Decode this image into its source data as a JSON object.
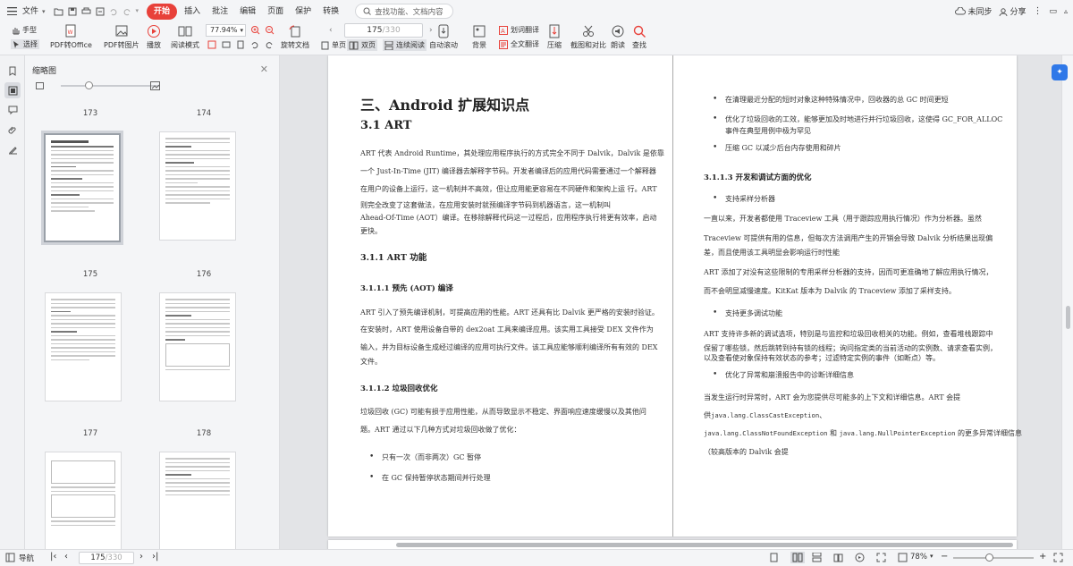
{
  "menubar": {
    "file_label": "文件",
    "menus": [
      "开始",
      "插入",
      "批注",
      "编辑",
      "页面",
      "保护",
      "转换"
    ],
    "search_placeholder": "查找功能、文档内容",
    "sync_label": "未同步",
    "share_label": "分享"
  },
  "toolbar": {
    "hand_label": "手型",
    "select_label": "选择",
    "pdf_to_office": "PDF转Office",
    "pdf_to_image": "PDF转图片",
    "play": "播放",
    "read_mode": "阅读模式",
    "zoom_value": "77.94%",
    "rotate": "旋转文档",
    "single_page": "单页",
    "double_page": "双页",
    "continuous": "连续阅读",
    "auto_scroll": "自动滚动",
    "background": "背景",
    "translate_word": "划词翻译",
    "translate_full": "全文翻译",
    "compress": "压缩",
    "screenshot_compare": "截图和对比",
    "read_aloud": "朗读",
    "find": "查找",
    "page_current": "175",
    "page_total": "/330"
  },
  "thumbpanel": {
    "title": "缩略图",
    "page_labels": [
      "173",
      "174",
      "175",
      "176",
      "177",
      "178"
    ]
  },
  "document": {
    "left": {
      "chapter": "三、Android 扩展知识点",
      "section": "3.1 ART",
      "intro_lines": [
        "ART 代表 Android Runtime，其处理应用程序执行的方式完全不同于 Dalvik，Dalvik 是依靠",
        "一个 Just-In-Time (JIT) 编译器去解释字节码。开发者编译后的应用代码需要通过一个解释器",
        "在用户的设备上运行，这一机制并不高效，但让应用能更容易在不同硬件和架构上运 行。ART",
        "则完全改变了这套做法，在应用安装时就预编译字节码到机器语言，这一机制叫",
        "Ahead-Of-Time (AOT）编译。在移除解释代码这一过程后，应用程序执行将更有效率，启动",
        "更快。"
      ],
      "h_311": "3.1.1 ART 功能",
      "h_3111": "3.1.1.1 预先 (AOT) 编译",
      "aot_lines": [
        "ART 引入了预先编译机制，可提高应用的性能。ART 还具有比 Dalvik 更严格的安装时验证。",
        "在安装时，ART 使用设备自带的 dex2oat 工具来编译应用。该实用工具接受 DEX 文件作为",
        "输入，并为目标设备生成经过编译的应用可执行文件。该工具应能够顺利编译所有有效的 DEX",
        "文件。"
      ],
      "h_3112": "3.1.1.2 垃圾回收优化",
      "gc_lines": [
        "垃圾回收 (GC) 可能有损于应用性能，从而导致显示不稳定、界面响应速度缓慢以及其他问",
        "题。ART 通过以下几种方式对垃圾回收做了优化："
      ],
      "gc_bullets": [
        "只有一次（而非两次）GC 暂停",
        "在 GC 保持暂停状态期间并行处理"
      ]
    },
    "right": {
      "top_bullets": [
        "在清理最近分配的短时对象这种特殊情况中，回收器的总 GC 时间更短",
        "优化了垃圾回收的工效，能够更加及时地进行并行垃圾回收，这使得 GC_FOR_ALLOC",
        "事件在典型用例中极为罕见",
        "压缩 GC 以减少后台内存使用和碎片"
      ],
      "h_3113": "3.1.1.3 开发和调试方面的优化",
      "bullet_sampling": "支持采样分析器",
      "sampling_lines": [
        "一直以来，开发者都使用 Traceview 工具（用于跟踪应用执行情况）作为分析器。虽然",
        "Traceview 可提供有用的信息，但每次方法调用产生的开销会导致 Dalvik 分析结果出现偏",
        "差，而且使用该工具明显会影响运行时性能"
      ],
      "art_sampling_lines": [
        "ART 添加了对没有这些限制的专用采样分析器的支持，因而可更准确地了解应用执行情况，",
        "而不会明显减慢速度。KitKat 版本为 Dalvik 的 Traceview 添加了采样支持。"
      ],
      "bullet_debug": "支持更多调试功能",
      "debug_lines": [
        "ART 支持许多新的调试选项，特别是与监控和垃圾回收相关的功能。例如，查看堆栈跟踪中",
        "保留了哪些锁，然后跳转到持有锁的线程；询问指定类的当前活动的实例数、请求查看实例，",
        "以及查看使对象保持有效状态的参考；过滤特定实例的事件（如断点）等。"
      ],
      "bullet_diag": "优化了异常和崩溃报告中的诊断详细信息",
      "diag_line1": "当发生运行时异常时，ART 会为您提供尽可能多的上下文和详细信息。ART 会提",
      "diag_line2_prefix": "供",
      "diag_code1": "java.lang.ClassCastException",
      "diag_line2_suffix": "、",
      "diag_code2": "java.lang.ClassNotFoundException",
      "diag_mid": " 和 ",
      "diag_code3": "java.lang.NullPointerException",
      "diag_line3_suffix": " 的更多异常详细信息",
      "diag_line4": "（较高版本的 Dalvik 会提"
    }
  },
  "statusbar": {
    "nav_label": "导航",
    "page_current": "175",
    "page_total": "/330",
    "zoom": "78%"
  },
  "colors": {
    "accent": "#e8413a",
    "badge": "#2f78e8"
  }
}
